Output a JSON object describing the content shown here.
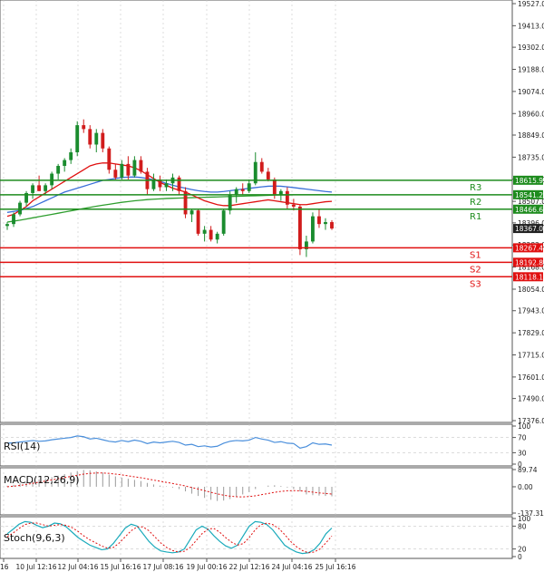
{
  "colors": {
    "up": "#1a8c2e",
    "down": "#d11c1c",
    "ma_red": "#e01010",
    "ma_blue": "#3a6fd8",
    "ma_green": "#2e9e2e",
    "resistance": "#1e8c1e",
    "support": "#e01010",
    "rsi_line": "#4a8fdc",
    "macd_signal": "#e01010",
    "macd_hist": "#9a9a9a",
    "stoch_main": "#1aaabb",
    "stoch_signal": "#e01010",
    "grid": "#c8c8c8",
    "axis": "#555555"
  },
  "chart_data": [
    {
      "type": "candlestick",
      "name": "price",
      "y_ticks": [
        "19527.0",
        "19413.0",
        "19302.0",
        "19188.0",
        "19074.0",
        "18960.0",
        "18849.0",
        "18735.0",
        "18621.0",
        "18507.0",
        "18396.0",
        "18282.0",
        "18168.0",
        "18054.0",
        "17943.0",
        "17829.0",
        "17715.0",
        "17601.0",
        "17490.0",
        "17376.0"
      ],
      "ylim": [
        17376,
        19527
      ],
      "x_ticks": [
        "16",
        "10 Jul 12:16",
        "12 Jul 04:16",
        "15 Jul 16:16",
        "17 Jul 08:16",
        "19 Jul 00:16",
        "22 Jul 12:16",
        "24 Jul 04:16",
        "25 Jul 16:16"
      ],
      "candles": [
        {
          "o": 18380,
          "h": 18400,
          "l": 18360,
          "c": 18390
        },
        {
          "o": 18390,
          "h": 18450,
          "l": 18375,
          "c": 18440
        },
        {
          "o": 18440,
          "h": 18510,
          "l": 18430,
          "c": 18500
        },
        {
          "o": 18500,
          "h": 18560,
          "l": 18480,
          "c": 18550
        },
        {
          "o": 18550,
          "h": 18600,
          "l": 18520,
          "c": 18590
        },
        {
          "o": 18590,
          "h": 18640,
          "l": 18560,
          "c": 18560
        },
        {
          "o": 18560,
          "h": 18600,
          "l": 18540,
          "c": 18590
        },
        {
          "o": 18590,
          "h": 18660,
          "l": 18570,
          "c": 18650
        },
        {
          "o": 18650,
          "h": 18700,
          "l": 18620,
          "c": 18690
        },
        {
          "o": 18690,
          "h": 18730,
          "l": 18660,
          "c": 18720
        },
        {
          "o": 18720,
          "h": 18780,
          "l": 18700,
          "c": 18760
        },
        {
          "o": 18760,
          "h": 18920,
          "l": 18740,
          "c": 18900
        },
        {
          "o": 18900,
          "h": 18930,
          "l": 18860,
          "c": 18880
        },
        {
          "o": 18880,
          "h": 18900,
          "l": 18780,
          "c": 18800
        },
        {
          "o": 18800,
          "h": 18880,
          "l": 18760,
          "c": 18860
        },
        {
          "o": 18860,
          "h": 18880,
          "l": 18760,
          "c": 18780
        },
        {
          "o": 18780,
          "h": 18790,
          "l": 18650,
          "c": 18670
        },
        {
          "o": 18670,
          "h": 18700,
          "l": 18620,
          "c": 18630
        },
        {
          "o": 18630,
          "h": 18720,
          "l": 18620,
          "c": 18700
        },
        {
          "o": 18700,
          "h": 18740,
          "l": 18620,
          "c": 18640
        },
        {
          "o": 18640,
          "h": 18740,
          "l": 18630,
          "c": 18720
        },
        {
          "o": 18720,
          "h": 18740,
          "l": 18650,
          "c": 18660
        },
        {
          "o": 18660,
          "h": 18680,
          "l": 18540,
          "c": 18570
        },
        {
          "o": 18570,
          "h": 18650,
          "l": 18560,
          "c": 18620
        },
        {
          "o": 18620,
          "h": 18640,
          "l": 18560,
          "c": 18580
        },
        {
          "o": 18580,
          "h": 18620,
          "l": 18560,
          "c": 18600
        },
        {
          "o": 18600,
          "h": 18650,
          "l": 18560,
          "c": 18630
        },
        {
          "o": 18630,
          "h": 18640,
          "l": 18540,
          "c": 18560
        },
        {
          "o": 18560,
          "h": 18580,
          "l": 18420,
          "c": 18440
        },
        {
          "o": 18440,
          "h": 18470,
          "l": 18400,
          "c": 18460
        },
        {
          "o": 18460,
          "h": 18470,
          "l": 18330,
          "c": 18340
        },
        {
          "o": 18340,
          "h": 18380,
          "l": 18300,
          "c": 18360
        },
        {
          "o": 18360,
          "h": 18380,
          "l": 18300,
          "c": 18310
        },
        {
          "o": 18310,
          "h": 18350,
          "l": 18290,
          "c": 18340
        },
        {
          "o": 18340,
          "h": 18470,
          "l": 18330,
          "c": 18460
        },
        {
          "o": 18460,
          "h": 18560,
          "l": 18440,
          "c": 18540
        },
        {
          "o": 18540,
          "h": 18580,
          "l": 18500,
          "c": 18570
        },
        {
          "o": 18570,
          "h": 18600,
          "l": 18540,
          "c": 18560
        },
        {
          "o": 18560,
          "h": 18620,
          "l": 18550,
          "c": 18600
        },
        {
          "o": 18600,
          "h": 18760,
          "l": 18590,
          "c": 18710
        },
        {
          "o": 18710,
          "h": 18730,
          "l": 18650,
          "c": 18660
        },
        {
          "o": 18660,
          "h": 18680,
          "l": 18610,
          "c": 18620
        },
        {
          "o": 18620,
          "h": 18630,
          "l": 18520,
          "c": 18540
        },
        {
          "o": 18540,
          "h": 18570,
          "l": 18510,
          "c": 18560
        },
        {
          "o": 18560,
          "h": 18580,
          "l": 18470,
          "c": 18490
        },
        {
          "o": 18490,
          "h": 18520,
          "l": 18460,
          "c": 18480
        },
        {
          "o": 18480,
          "h": 18490,
          "l": 18230,
          "c": 18260
        },
        {
          "o": 18260,
          "h": 18330,
          "l": 18220,
          "c": 18300
        },
        {
          "o": 18300,
          "h": 18450,
          "l": 18290,
          "c": 18430
        },
        {
          "o": 18430,
          "h": 18470,
          "l": 18370,
          "c": 18390
        },
        {
          "o": 18390,
          "h": 18420,
          "l": 18360,
          "c": 18400
        },
        {
          "o": 18400,
          "h": 18410,
          "l": 18360,
          "c": 18367
        }
      ],
      "ma_red": [
        18430,
        18440,
        18460,
        18480,
        18510,
        18530,
        18550,
        18570,
        18590,
        18610,
        18630,
        18650,
        18670,
        18690,
        18700,
        18705,
        18705,
        18700,
        18695,
        18690,
        18680,
        18665,
        18645,
        18625,
        18605,
        18590,
        18575,
        18565,
        18555,
        18540,
        18525,
        18510,
        18500,
        18490,
        18485,
        18485,
        18490,
        18495,
        18500,
        18505,
        18510,
        18515,
        18510,
        18505,
        18500,
        18495,
        18490,
        18490,
        18495,
        18500,
        18505,
        18507
      ],
      "ma_blue": [
        18450,
        18455,
        18460,
        18470,
        18480,
        18495,
        18510,
        18525,
        18540,
        18555,
        18565,
        18575,
        18585,
        18595,
        18605,
        18615,
        18620,
        18625,
        18630,
        18632,
        18633,
        18630,
        18625,
        18618,
        18610,
        18600,
        18590,
        18582,
        18575,
        18568,
        18562,
        18558,
        18555,
        18555,
        18558,
        18562,
        18566,
        18570,
        18574,
        18578,
        18582,
        18585,
        18586,
        18585,
        18582,
        18578,
        18574,
        18570,
        18566,
        18562,
        18558,
        18555
      ],
      "ma_green": [
        18400,
        18405,
        18410,
        18416,
        18422,
        18428,
        18434,
        18440,
        18446,
        18452,
        18458,
        18464,
        18470,
        18476,
        18482,
        18487,
        18492,
        18497,
        18502,
        18506,
        18510,
        18513,
        18516,
        18518,
        18520,
        18522,
        18523,
        18524,
        18525,
        18526,
        18527,
        18528,
        18529,
        18530,
        18531,
        18532,
        18533,
        18534,
        18535,
        18536,
        18537,
        18538,
        18539,
        18540,
        18540,
        18541,
        18541,
        18541,
        18541,
        18541,
        18541,
        18541
      ],
      "levels": [
        {
          "label": "R3",
          "value": 18615.9,
          "text": "18615.9",
          "kind": "resistance"
        },
        {
          "label": "R2",
          "value": 18541.2,
          "text": "18541.2",
          "kind": "resistance"
        },
        {
          "label": "R1",
          "value": 18466.6,
          "text": "18466.6",
          "kind": "resistance"
        },
        {
          "label": "S1",
          "value": 18267.4,
          "text": "18267.4",
          "kind": "support"
        },
        {
          "label": "S2",
          "value": 18192.8,
          "text": "18192.8",
          "kind": "support"
        },
        {
          "label": "S3",
          "value": 18118.1,
          "text": "18118.1",
          "kind": "support"
        }
      ],
      "current_price": {
        "value": 18367.0,
        "text": "18367.0"
      }
    },
    {
      "type": "line",
      "name": "RSI(14)",
      "title": "RSI(14)",
      "ylim": [
        0,
        100
      ],
      "y_ticks": [
        "100",
        "70",
        "30",
        "0"
      ],
      "values": [
        55,
        56,
        58,
        60,
        62,
        60,
        61,
        64,
        66,
        68,
        70,
        74,
        72,
        66,
        68,
        64,
        60,
        58,
        62,
        59,
        63,
        60,
        54,
        58,
        56,
        58,
        60,
        57,
        50,
        52,
        46,
        48,
        45,
        47,
        55,
        60,
        62,
        61,
        63,
        70,
        66,
        63,
        57,
        59,
        55,
        54,
        42,
        46,
        56,
        52,
        53,
        50
      ]
    },
    {
      "type": "line",
      "name": "MACD(12,26,9)",
      "title": "MACD(12,26,9)",
      "ylim": [
        -137.31,
        89.74
      ],
      "y_ticks": [
        "89.74",
        "0.00",
        "-137.31"
      ],
      "histogram": [
        5,
        10,
        18,
        25,
        32,
        38,
        44,
        50,
        58,
        66,
        74,
        82,
        88,
        86,
        80,
        74,
        64,
        54,
        48,
        42,
        36,
        30,
        20,
        12,
        6,
        2,
        -4,
        -12,
        -24,
        -36,
        -48,
        -58,
        -68,
        -74,
        -72,
        -64,
        -52,
        -40,
        -28,
        -12,
        0,
        6,
        8,
        4,
        -4,
        -12,
        -24,
        -40,
        -44,
        -46,
        -48,
        -50
      ],
      "signal": [
        0,
        3,
        7,
        12,
        18,
        24,
        30,
        36,
        42,
        48,
        54,
        60,
        66,
        70,
        72,
        72,
        70,
        66,
        62,
        57,
        52,
        47,
        41,
        35,
        29,
        23,
        17,
        11,
        4,
        -4,
        -12,
        -20,
        -29,
        -37,
        -44,
        -49,
        -52,
        -53,
        -51,
        -47,
        -41,
        -35,
        -29,
        -24,
        -21,
        -20,
        -21,
        -24,
        -28,
        -32,
        -35,
        -38
      ]
    },
    {
      "type": "line",
      "name": "Stoch(9,6,3)",
      "title": "Stoch(9,6,3)",
      "ylim": [
        0,
        100
      ],
      "y_ticks": [
        "100",
        "80",
        "20",
        "0"
      ],
      "main": [
        60,
        72,
        85,
        92,
        90,
        82,
        76,
        80,
        88,
        86,
        78,
        64,
        50,
        40,
        30,
        24,
        18,
        20,
        35,
        55,
        75,
        85,
        80,
        60,
        40,
        25,
        15,
        12,
        10,
        12,
        20,
        45,
        70,
        80,
        72,
        55,
        40,
        28,
        22,
        30,
        55,
        80,
        92,
        90,
        84,
        70,
        50,
        30,
        20,
        12,
        8,
        10,
        18,
        35,
        60,
        75
      ],
      "signal": [
        52,
        62,
        74,
        84,
        88,
        88,
        84,
        80,
        82,
        84,
        82,
        76,
        66,
        54,
        44,
        36,
        28,
        22,
        24,
        36,
        52,
        68,
        78,
        78,
        68,
        52,
        36,
        24,
        16,
        12,
        14,
        24,
        42,
        60,
        72,
        74,
        64,
        50,
        38,
        30,
        34,
        50,
        70,
        84,
        88,
        84,
        74,
        58,
        40,
        26,
        16,
        10,
        12,
        20,
        36,
        54
      ]
    }
  ]
}
